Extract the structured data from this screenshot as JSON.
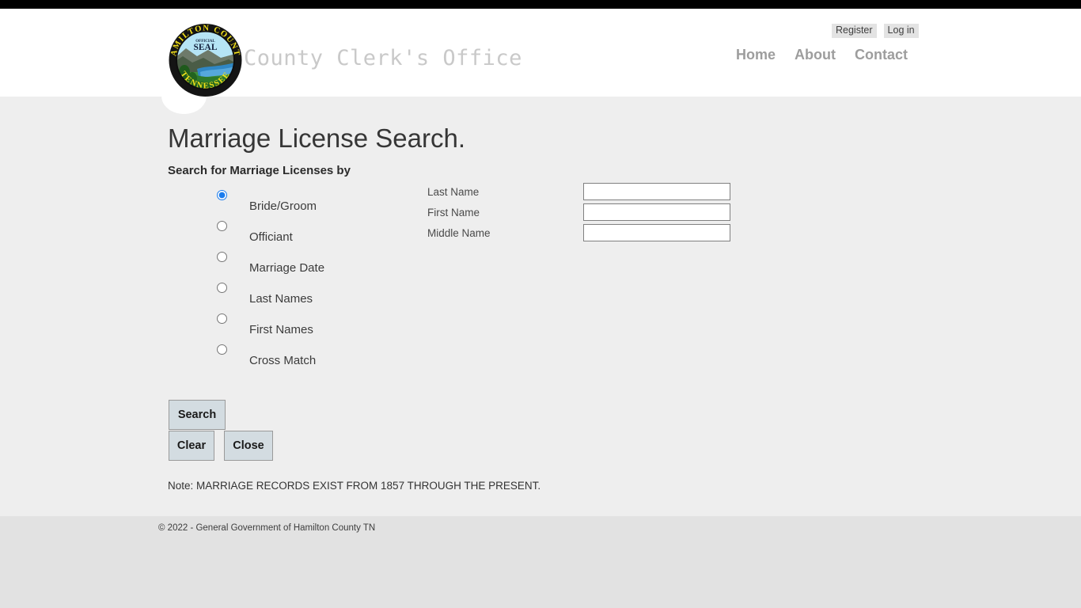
{
  "header": {
    "site_title": "County Clerk's Office",
    "logo_alt": "Hamilton County Tennessee Official Seal",
    "seal": {
      "top_text": "HAMILTON COUNTY",
      "bottom_text": "TENNESSEE",
      "center_small_text": "OFFICIAL",
      "center_text": "SEAL"
    },
    "auth": [
      {
        "label": "Register",
        "name": "register-link"
      },
      {
        "label": "Log in",
        "name": "login-link"
      }
    ],
    "nav": [
      {
        "label": "Home",
        "name": "nav-home"
      },
      {
        "label": "About",
        "name": "nav-about"
      },
      {
        "label": "Contact",
        "name": "nav-contact"
      }
    ]
  },
  "main": {
    "page_title": "Marriage License Search.",
    "section_label": "Search for Marriage Licenses by",
    "search_options": [
      {
        "label": "Bride/Groom",
        "value": "bride-groom",
        "selected": true
      },
      {
        "label": "Officiant",
        "value": "officiant",
        "selected": false
      },
      {
        "label": "Marriage Date",
        "value": "marriage-date",
        "selected": false
      },
      {
        "label": "Last Names",
        "value": "last-names",
        "selected": false
      },
      {
        "label": "First Names",
        "value": "first-names",
        "selected": false
      },
      {
        "label": "Cross Match",
        "value": "cross-match",
        "selected": false
      }
    ],
    "fields": [
      {
        "label": "Last Name",
        "value": "",
        "placeholder": "",
        "name": "last-name-input"
      },
      {
        "label": "First Name",
        "value": "",
        "placeholder": "",
        "name": "first-name-input"
      },
      {
        "label": "Middle Name",
        "value": "",
        "placeholder": "",
        "name": "middle-name-input"
      }
    ],
    "buttons": {
      "search": "Search",
      "clear": "Clear",
      "close": "Close"
    },
    "note": "Note: MARRIAGE RECORDS EXIST FROM 1857 THROUGH THE PRESENT."
  },
  "footer": {
    "copyright": "© 2022 - General Government of Hamilton County TN"
  },
  "colors": {
    "topbar": "#000000",
    "header_bg": "#ffffff",
    "content_bg": "#eeeeee",
    "footer_bg": "#e2e2e2",
    "button_bg": "#d3dce1",
    "title_gray": "#c9c9c9",
    "radio_accent": "#1b7ced"
  }
}
